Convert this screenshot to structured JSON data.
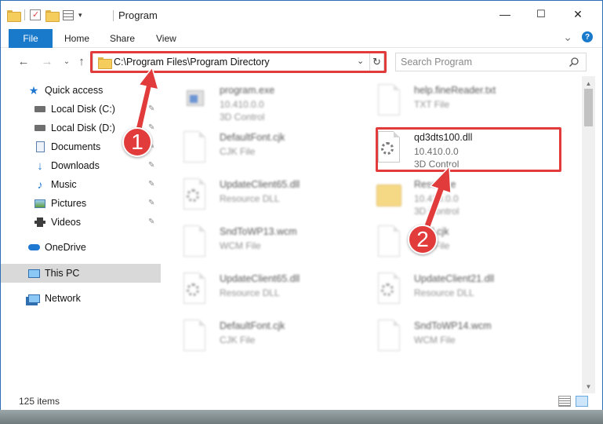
{
  "window": {
    "title": "Program",
    "minimize": "—",
    "maximize": "☐",
    "close": "✕"
  },
  "ribbon": {
    "tabs": [
      "File",
      "Home",
      "Share",
      "View"
    ],
    "expand": "⌄",
    "help": "?"
  },
  "nav": {
    "back": "←",
    "forward": "→",
    "recent": "⌄",
    "up": "↑",
    "address": "C:\\Program Files\\Program Directory",
    "address_dropdown": "⌄",
    "refresh": "↻",
    "search_placeholder": "Search Program"
  },
  "sidebar": {
    "items": [
      {
        "label": "Quick access",
        "icon": "star-icon",
        "pinned": false
      },
      {
        "label": "Local Disk (C:)",
        "icon": "drive-icon",
        "pinned": true
      },
      {
        "label": "Local Disk (D:)",
        "icon": "drive-icon",
        "pinned": true
      },
      {
        "label": "Documents",
        "icon": "documents-icon",
        "pinned": true
      },
      {
        "label": "Downloads",
        "icon": "download-arrow-icon",
        "pinned": true
      },
      {
        "label": "Music",
        "icon": "music-note-icon",
        "pinned": true
      },
      {
        "label": "Pictures",
        "icon": "pictures-icon",
        "pinned": true
      },
      {
        "label": "Videos",
        "icon": "film-icon",
        "pinned": true
      },
      {
        "label": "OneDrive",
        "icon": "cloud-icon",
        "pinned": false
      },
      {
        "label": "This PC",
        "icon": "computer-icon",
        "pinned": false,
        "selected": true
      },
      {
        "label": "Network",
        "icon": "network-icon",
        "pinned": false
      }
    ]
  },
  "files": [
    {
      "name": "program.exe",
      "meta1": "10.410.0.0",
      "meta2": "3D Control",
      "icon": "exe-icon"
    },
    {
      "name": "help.fineReader.txt",
      "meta1": "TXT File",
      "meta2": "",
      "icon": "doc-icon"
    },
    {
      "name": "DefaultFont.cjk",
      "meta1": "CJK File",
      "meta2": "",
      "icon": "doc-icon"
    },
    {
      "name": "qd3dts100.dll",
      "meta1": "10.410.0.0",
      "meta2": "3D Control",
      "icon": "dll-gear-icon",
      "highlighted": true
    },
    {
      "name": "UpdateClient65.dll",
      "meta1": "Resource DLL",
      "meta2": "",
      "icon": "dll-gear-icon"
    },
    {
      "name": "Resource",
      "meta1": "10.410.0.0",
      "meta2": "3D Control",
      "icon": "folder-icon"
    },
    {
      "name": "SndToWP13.wcm",
      "meta1": "WCM File",
      "meta2": "",
      "icon": "doc-icon"
    },
    {
      "name": "Html.cjk",
      "meta1": "CJK File",
      "meta2": "",
      "icon": "doc-icon"
    },
    {
      "name": "UpdateClient65.dll",
      "meta1": "Resource DLL",
      "meta2": "",
      "icon": "dll-gear-icon"
    },
    {
      "name": "UpdateClient21.dll",
      "meta1": "Resource DLL",
      "meta2": "",
      "icon": "dll-gear-icon"
    },
    {
      "name": "DefaultFont.cjk",
      "meta1": "CJK File",
      "meta2": "",
      "icon": "doc-icon"
    },
    {
      "name": "SndToWP14.wcm",
      "meta1": "WCM File",
      "meta2": "",
      "icon": "doc-icon"
    }
  ],
  "status": {
    "item_count": "125 items"
  },
  "annotations": {
    "marker1": "1",
    "marker2": "2",
    "color": "#e23b3b"
  }
}
